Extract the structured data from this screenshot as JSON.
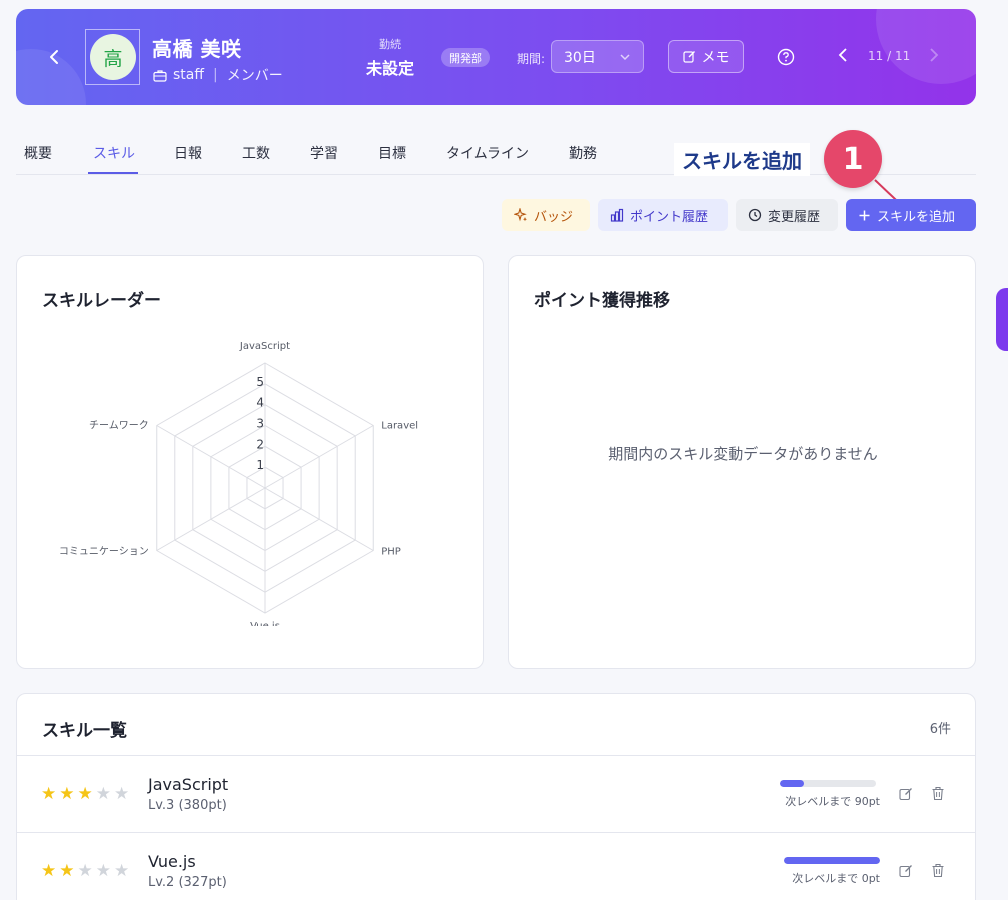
{
  "header": {
    "avatar_initial": "高",
    "user_name": "高橋 美咲",
    "role": "staff",
    "position": "メンバー",
    "tenure_label": "勤続",
    "tenure_value": "未設定",
    "department": "開発部",
    "period_label": "期間:",
    "period_value": "30日",
    "memo_label": "メモ",
    "nav_count": "11 / 11"
  },
  "tabs": [
    "概要",
    "スキル",
    "日報",
    "工数",
    "学習",
    "目標",
    "タイムライン",
    "勤務"
  ],
  "active_tab": "スキル",
  "annotation": {
    "label": "スキルを追加",
    "number": "1"
  },
  "actions": {
    "badge": "バッジ",
    "points_history": "ポイント履歴",
    "change_history": "変更履歴",
    "add_skill": "スキルを追加"
  },
  "radar": {
    "title": "スキルレーダー",
    "axes": [
      "JavaScript",
      "Laravel",
      "PHP",
      "Vue.js",
      "コミュニケーション",
      "チームワーク"
    ],
    "scale_labels": [
      "1",
      "2",
      "3",
      "4",
      "5"
    ]
  },
  "points_chart": {
    "title": "ポイント獲得推移",
    "empty_message": "期間内のスキル変動データがありません"
  },
  "skill_list": {
    "title": "スキル一覧",
    "count": "6件",
    "items": [
      {
        "name": "JavaScript",
        "level_text": "Lv.3 (380pt)",
        "stars": 3,
        "progress": 0.25,
        "next_text": "次レベルまで 90pt"
      },
      {
        "name": "Vue.js",
        "level_text": "Lv.2 (327pt)",
        "stars": 2,
        "progress": 1.0,
        "next_text": "次レベルまで 0pt"
      }
    ]
  },
  "colors": {
    "accent": "#6366f1",
    "star_on": "#f5c518",
    "star_off": "#d1d5db",
    "annotation": "#e5476a"
  }
}
